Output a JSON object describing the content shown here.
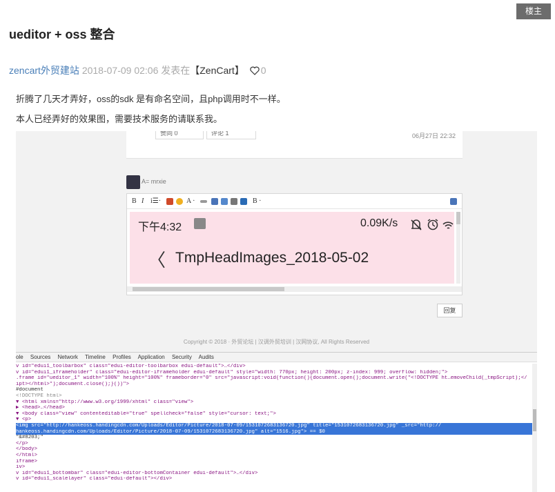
{
  "floor_badge": "楼主",
  "post": {
    "title": "ueditor + oss 整合",
    "author": "zencart外贸建站",
    "date": "2018-07-09 02:06",
    "posted_in": "发表在",
    "forum": "【ZenCart】",
    "likes": "0",
    "paragraphs": [
      "折腾了几天才弄好，oss的sdk 是有命名空间，且php调用时不一样。",
      "本人已经弄好的效果图，需要技术服务的请联系我。"
    ]
  },
  "shot": {
    "like_btn": "赞同 0",
    "comment_btn": "评论 1",
    "card_date": "06月27日 22:32",
    "reply_user": "A= mrxie",
    "toolbar": [
      "B",
      "I",
      "i☰·",
      "A ·",
      "B ·"
    ],
    "phone_time": "下午4:32",
    "phone_speed": "0.09K/s",
    "phone_back": "〈",
    "phone_folder": "TmpHeadImages_2018-05-02",
    "reply_btn": "回复",
    "copyright": "Copyright © 2018 · 外贸论坛 | 汉调外贸培训 | 汉网协议, All Rights Reserved",
    "devtools_tabs": [
      "ole",
      "Sources",
      "Network",
      "Timeline",
      "Profiles",
      "Application",
      "Security",
      "Audits"
    ],
    "devtools_lines": [
      "v id=\"edui1_toolbarbox\" class=\"edui-editor-toolbarbox edui-default\">…</div>",
      "v id=\"edui1_iframeholder\" class=\"edui-editor-iframeholder edui-default\" style=\"width: 770px; height: 200px; z-index: 999; overflow: hidden;\">",
      ".frame id=\"ueditor_1\" width=\"100%\" height=\"100%\" frameborder=\"0\" src=\"javascript:void(function(){document.open();document.write(\"<!DOCTYPE ht…emoveChild(_tmpScript);</",
      "ipt></html>\");document.close();}())\">",
      "#document",
      "  <!DOCTYPE html>",
      "▼ <html xmlns=\"http://www.w3.org/1999/xhtml\" class=\"view\">",
      "   ▶ <head>…</head>",
      "   ▼ <body class=\"view\" contenteditable=\"true\" spellcheck=\"false\" style=\"cursor: text;\">",
      "      ▼ <p>",
      "         <img src=\"http://hankeoss.handingcdn.com/Uploads/Editor/Picture/2018-07-09/1531072683136720.jpg\" title=\"1531072683136720.jpg\" _src=\"http://",
      "         hankeoss.handingcdn.com/Uploads/Editor/Picture/2018-07-09/1531072683136720.jpg\" alt=\"1516.jpg\"> == $0",
      "         \"&#8203;\"",
      "       </p>",
      "     </body>",
      "   </html>",
      "iframe>",
      "iv>",
      "v id=\"edui1_bottombar\" class=\"edui-editor-bottomContainer edui-default\">…</div>",
      "v id=\"edui1_scalelayer\" class=\"edui-default\"></div>"
    ]
  }
}
